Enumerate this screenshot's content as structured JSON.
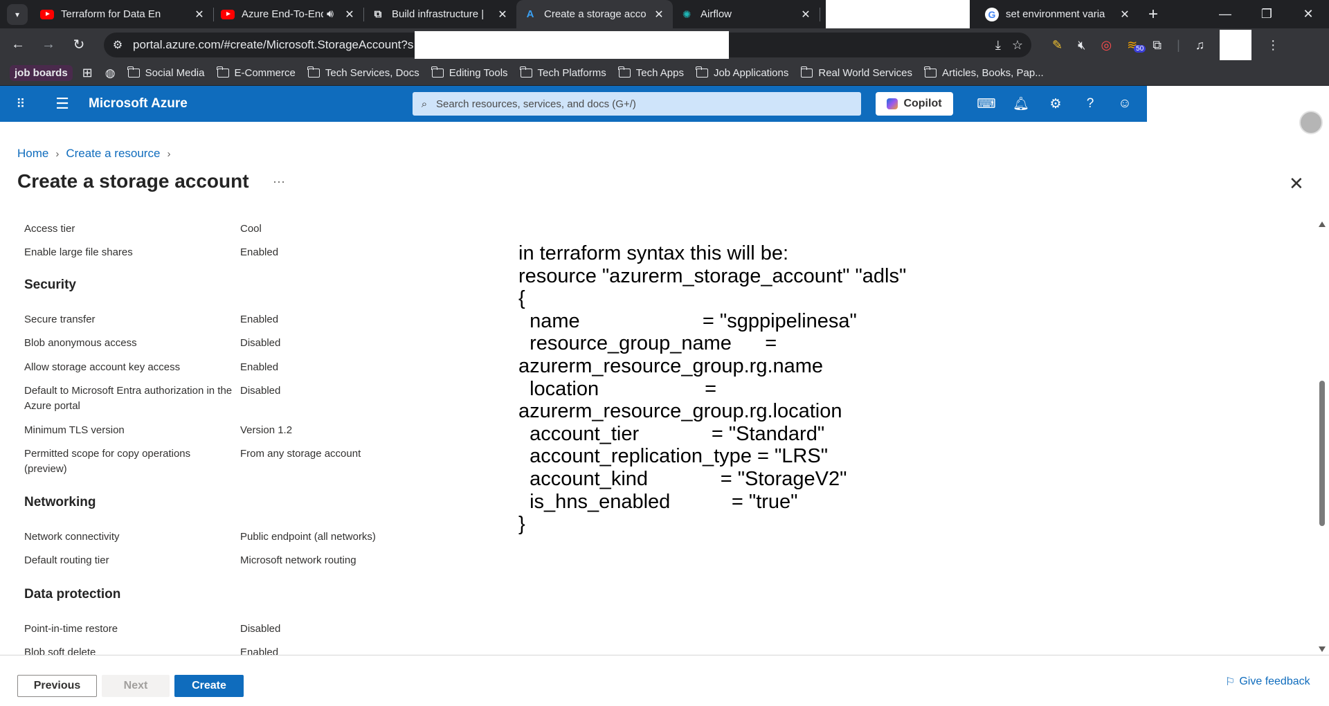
{
  "browser": {
    "tabs": [
      {
        "title": "Terraform for Data En",
        "icon": "youtube-icon",
        "active": false
      },
      {
        "title": "Azure End-To-End",
        "icon": "youtube-icon",
        "active": false,
        "audio": true
      },
      {
        "title": "Build infrastructure |",
        "icon": "hashicorp-icon",
        "active": false
      },
      {
        "title": "Create a storage acco",
        "icon": "azure-icon",
        "active": true
      },
      {
        "title": "Airflow",
        "icon": "airflow-icon",
        "active": false
      },
      {
        "title": "",
        "icon": "",
        "active": false,
        "redacted": true
      },
      {
        "title": "set environment varia",
        "icon": "google-icon",
        "active": false
      }
    ],
    "url": "portal.azure.com/#create/Microsoft.StorageAccount?s",
    "extension_badge": "50",
    "bookmarks": [
      {
        "label": "job boards",
        "type": "pill"
      },
      {
        "label": "Social Media",
        "type": "folder"
      },
      {
        "label": "E-Commerce",
        "type": "folder"
      },
      {
        "label": "Tech Services, Docs",
        "type": "folder"
      },
      {
        "label": "Editing Tools",
        "type": "folder"
      },
      {
        "label": "Tech Platforms",
        "type": "folder"
      },
      {
        "label": "Tech Apps",
        "type": "folder"
      },
      {
        "label": "Job Applications",
        "type": "folder"
      },
      {
        "label": "Real World Services",
        "type": "folder"
      },
      {
        "label": "Articles, Books, Pap...",
        "type": "folder"
      }
    ]
  },
  "azure": {
    "brand": "Microsoft Azure",
    "search_placeholder": "Search resources, services, and docs (G+/)",
    "copilot_label": "Copilot",
    "accent": "#0f6cbd"
  },
  "page": {
    "breadcrumb": [
      "Home",
      "Create a resource"
    ],
    "title": "Create a storage account",
    "more": "···"
  },
  "review": {
    "rows_top": [
      {
        "label": "Access tier",
        "value": "Cool"
      },
      {
        "label": "Enable large file shares",
        "value": "Enabled"
      }
    ],
    "security_title": "Security",
    "security": [
      {
        "label": "Secure transfer",
        "value": "Enabled"
      },
      {
        "label": "Blob anonymous access",
        "value": "Disabled"
      },
      {
        "label": "Allow storage account key access",
        "value": "Enabled"
      },
      {
        "label": "Default to Microsoft Entra authorization in the Azure portal",
        "value": "Disabled"
      },
      {
        "label": "Minimum TLS version",
        "value": "Version 1.2"
      },
      {
        "label": "Permitted scope for copy operations (preview)",
        "value": "From any storage account"
      }
    ],
    "networking_title": "Networking",
    "networking": [
      {
        "label": "Network connectivity",
        "value": "Public endpoint (all networks)"
      },
      {
        "label": "Default routing tier",
        "value": "Microsoft network routing"
      }
    ],
    "data_protection_title": "Data protection",
    "data_protection": [
      {
        "label": "Point-in-time restore",
        "value": "Disabled"
      },
      {
        "label": "Blob soft delete",
        "value": "Enabled"
      }
    ]
  },
  "overlay_note": "in terraform syntax this will be:\nresource \"azurerm_storage_account\" \"adls\"\n{\n  name                      = \"sgppipelinesa\"\n  resource_group_name      =\nazurerm_resource_group.rg.name\n  location                   =\nazurerm_resource_group.rg.location\n  account_tier             = \"Standard\"\n  account_replication_type = \"LRS\"\n  account_kind             = \"StorageV2\"\n  is_hns_enabled           = \"true\"\n}",
  "footer": {
    "previous": "Previous",
    "next": "Next",
    "create": "Create",
    "feedback": "Give feedback"
  }
}
